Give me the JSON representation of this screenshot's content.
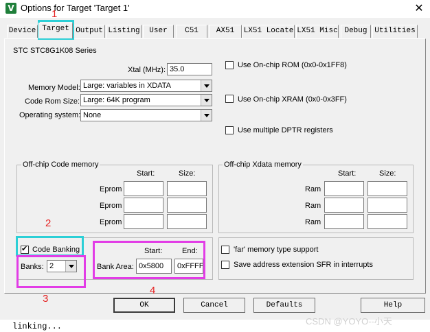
{
  "window": {
    "title": "Options for Target 'Target 1'",
    "icon": "keil-uvision-icon",
    "close_glyph": "✕"
  },
  "tabs": [
    "Device",
    "Target",
    "Output",
    "Listing",
    "User",
    "C51",
    "AX51",
    "LX51 Locate",
    "LX51 Misc",
    "Debug",
    "Utilities"
  ],
  "active_tab": "Target",
  "device_name": "STC STC8G1K08 Series",
  "xtal": {
    "label": "Xtal (MHz):",
    "value": "35.0"
  },
  "memory_model": {
    "label": "Memory Model:",
    "value": "Large: variables in XDATA"
  },
  "code_rom_size": {
    "label": "Code Rom Size:",
    "value": "Large: 64K program"
  },
  "operating_system": {
    "label": "Operating system:",
    "value": "None"
  },
  "options_right": {
    "use_onchip_rom": "Use On-chip ROM (0x0-0x1FF8)",
    "use_onchip_xram": "Use On-chip XRAM (0x0-0x3FF)",
    "use_multiple_dptr": "Use multiple DPTR registers"
  },
  "offchip_code": {
    "title": "Off-chip Code memory",
    "start_header": "Start:",
    "size_header": "Size:",
    "rows": [
      "Eprom",
      "Eprom",
      "Eprom"
    ]
  },
  "offchip_xdata": {
    "title": "Off-chip Xdata memory",
    "start_header": "Start:",
    "size_header": "Size:",
    "rows": [
      "Ram",
      "Ram",
      "Ram"
    ]
  },
  "code_banking": {
    "label": "Code Banking",
    "checked": true,
    "banks_label": "Banks:",
    "banks_value": "2"
  },
  "bank_area": {
    "label": "Bank Area:",
    "start_header": "Start:",
    "end_header": "End:",
    "start": "0x5800",
    "end": "0xFFFF"
  },
  "far_options": {
    "far_memory": "'far' memory type support",
    "save_sfr": "Save address extension SFR in interrupts"
  },
  "buttons": {
    "ok": "OK",
    "cancel": "Cancel",
    "defaults": "Defaults",
    "help": "Help"
  },
  "annotations": [
    "1",
    "2",
    "3",
    "4"
  ],
  "console_text": "linking...",
  "watermark": "CSDN @YOYO--小天",
  "colors": {
    "highlight_cyan": "#2ccfd6",
    "highlight_magenta": "#e23ce6",
    "annotation_red": "#e52020"
  }
}
